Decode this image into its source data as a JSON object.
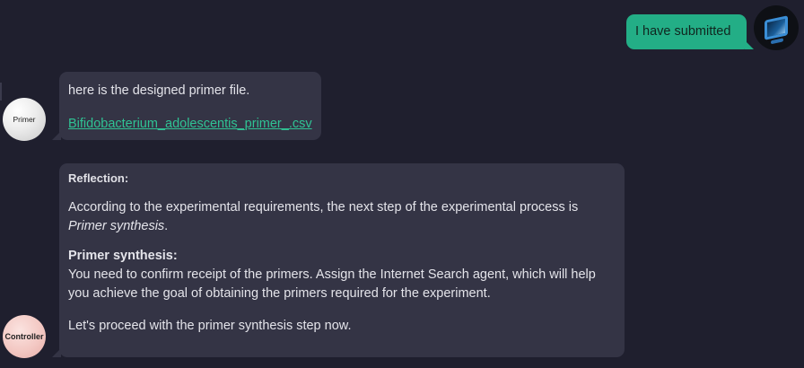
{
  "user": {
    "message": "I have submitted",
    "avatar_icon": "computer-monitor-icon"
  },
  "primer_agent": {
    "avatar_label": "Primer",
    "message": "here is the designed primer file.",
    "file_link": "Bifidobacterium_adolescentis_primer_.csv"
  },
  "controller_agent": {
    "avatar_label": "Controller",
    "reflection_title": "Reflection:",
    "reflection_text": "According to the experimental requirements, the next step of the experimental process is",
    "reflection_step": "Primer synthesis",
    "reflection_period": ".",
    "section_title": "Primer synthesis:",
    "section_line1": "You need to confirm receipt of the primers. Assign the Internet Search agent, which will help",
    "section_line2": "you achieve the goal of obtaining the primers required for the experiment.",
    "closing": "Let's proceed with the primer synthesis step now."
  },
  "colors": {
    "background": "#1f1f2e",
    "user_bubble": "#23ae86",
    "agent_bubble": "#343445",
    "link": "#2fc394"
  }
}
